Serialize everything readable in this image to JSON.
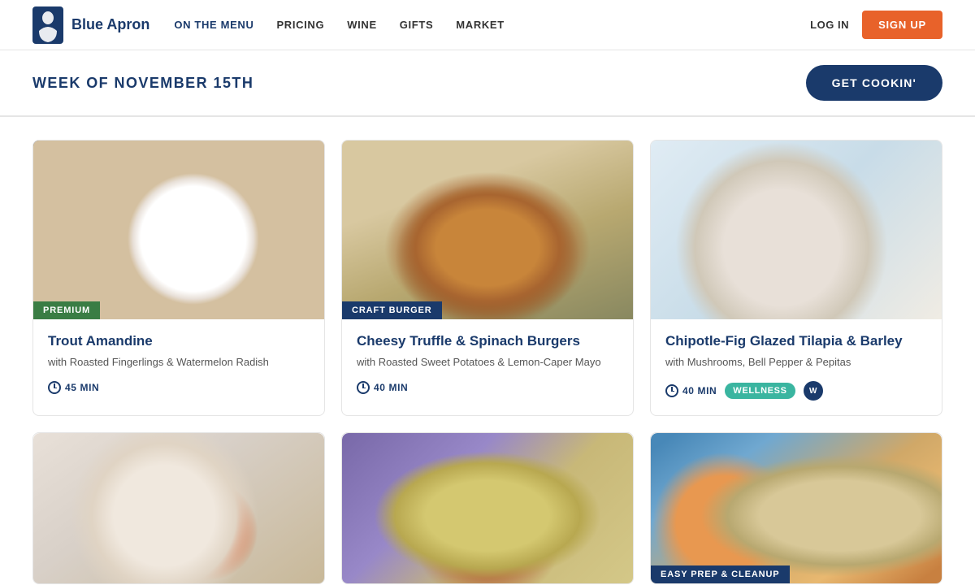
{
  "brand": {
    "name": "Blue Apron",
    "logo_lines": [
      "Blue",
      "Apron"
    ]
  },
  "navbar": {
    "links": [
      {
        "id": "on-the-menu",
        "label": "ON THE MENU",
        "active": true
      },
      {
        "id": "pricing",
        "label": "PRICING",
        "active": false
      },
      {
        "id": "wine",
        "label": "WINE",
        "active": false
      },
      {
        "id": "gifts",
        "label": "GIFTS",
        "active": false
      },
      {
        "id": "market",
        "label": "MARKET",
        "active": false
      }
    ],
    "login_label": "LOG IN",
    "signup_label": "SIGN UP"
  },
  "week_banner": {
    "title": "WEEK OF NOVEMBER 15TH",
    "cta_label": "GET COOKIN'"
  },
  "recipes": [
    {
      "id": "trout",
      "badge": "PREMIUM",
      "badge_type": "premium",
      "title": "Trout Amandine",
      "subtitle": "with Roasted Fingerlings & Watermelon Radish",
      "time": "45 MIN",
      "tags": []
    },
    {
      "id": "burger",
      "badge": "CRAFT BURGER",
      "badge_type": "craft",
      "title": "Cheesy Truffle & Spinach Burgers",
      "subtitle": "with Roasted Sweet Potatoes & Lemon-Caper Mayo",
      "time": "40 MIN",
      "tags": []
    },
    {
      "id": "tilapia",
      "badge": null,
      "badge_type": null,
      "title": "Chipotle-Fig Glazed Tilapia & Barley",
      "subtitle": "with Mushrooms, Bell Pepper & Pepitas",
      "time": "40 MIN",
      "tags": [
        "WELLNESS",
        "WW"
      ]
    },
    {
      "id": "chicken",
      "badge": null,
      "badge_type": null,
      "title": "",
      "subtitle": "",
      "time": "",
      "tags": []
    },
    {
      "id": "pork",
      "badge": null,
      "badge_type": null,
      "title": "",
      "subtitle": "",
      "time": "",
      "tags": []
    },
    {
      "id": "tacos",
      "badge": "EASY PREP & CLEANUP",
      "badge_type": "easy",
      "title": "",
      "subtitle": "",
      "time": "",
      "tags": []
    }
  ]
}
